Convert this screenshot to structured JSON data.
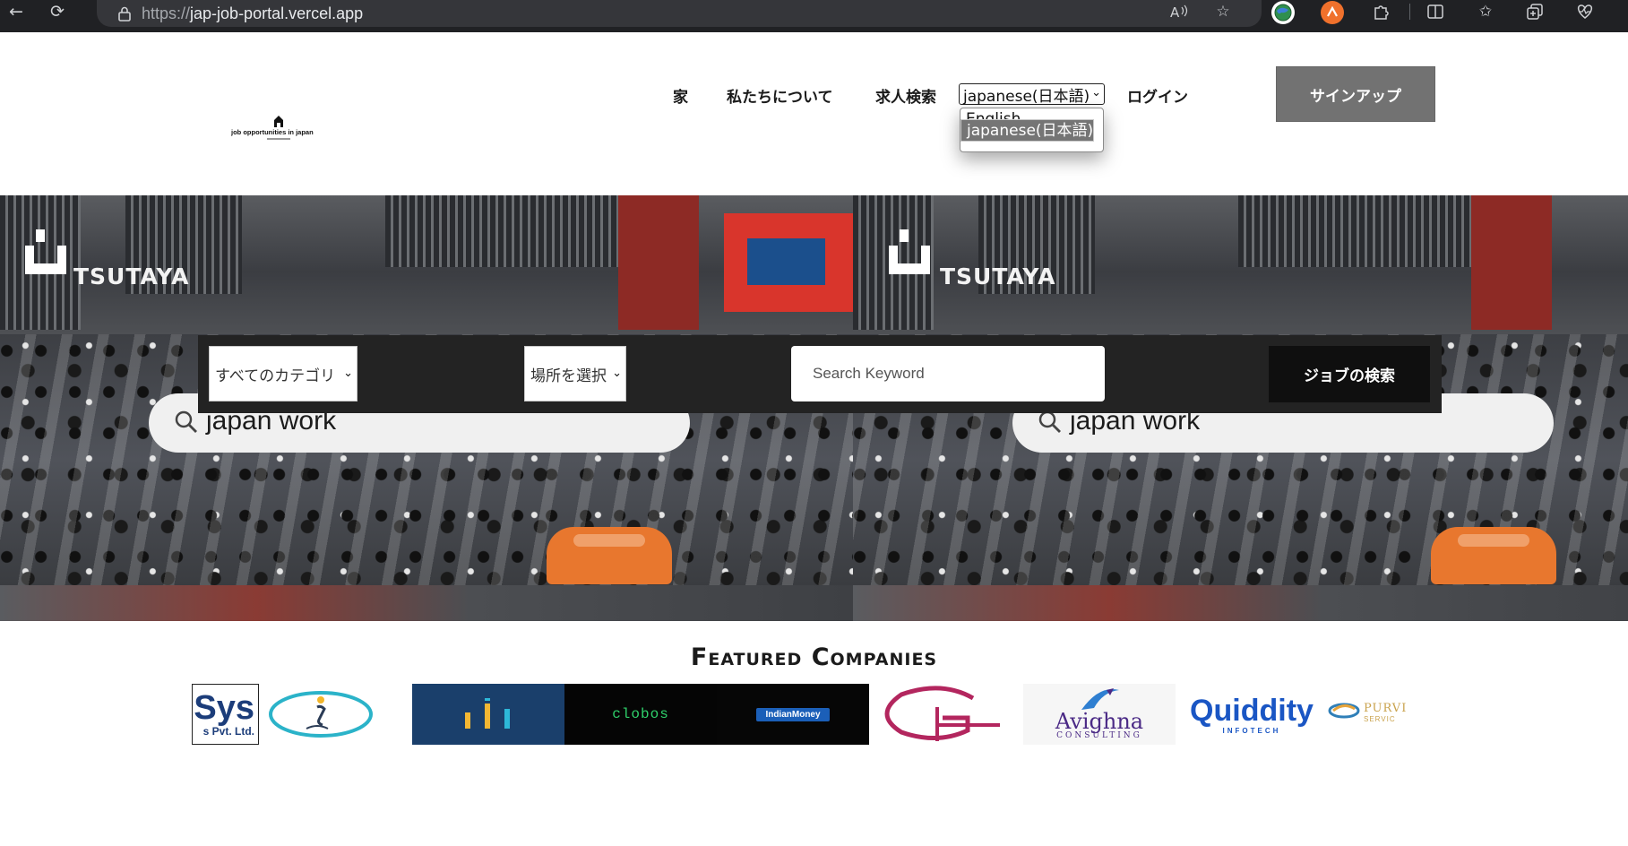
{
  "browser": {
    "url_scheme": "https://",
    "url_host": "jap-job-portal.vercel.app",
    "back_icon": "back-arrow-icon",
    "reload_icon": "reload-icon",
    "toolbar_icons": [
      "read-aloud-icon",
      "favorite-star-icon",
      "extension-globe-icon",
      "extension-orange-icon",
      "extensions-puzzle-icon",
      "split-screen-icon",
      "favorites-icon",
      "collections-icon",
      "browser-health-icon"
    ]
  },
  "brand": {
    "logo_text": "job opportunities in japan"
  },
  "nav": {
    "home": "家",
    "about": "私たちについて",
    "job_search": "求人検索",
    "language_selected": "japanese(日本語)",
    "language_options": [
      "English",
      "japanese(日本語)"
    ],
    "login": "ログイン",
    "signup": "サインアップ"
  },
  "hero": {
    "sign_text": "TSUTAYA",
    "overlay_search_text": "japan work",
    "category_select": "すべてのカテゴリ",
    "location_select": "場所を選択",
    "keyword_placeholder": "Search Keyword",
    "find_jobs_button": "ジョブの検索"
  },
  "featured": {
    "title": "Featured Companies",
    "companies": [
      {
        "name": "Sys",
        "sub": "s Pvt. Ltd."
      },
      {
        "name": "circle-figure-logo"
      },
      {
        "name": "bars-logo"
      },
      {
        "name": "clobos"
      },
      {
        "name": "IndianMoney"
      },
      {
        "name": "G-monogram-logo"
      },
      {
        "name": "Avighna",
        "sub": "CONSULTING"
      },
      {
        "name": "Quiddity",
        "sub": "INFOTECH"
      },
      {
        "name": "PURVI",
        "sub": "SERVIC"
      }
    ]
  },
  "colors": {
    "signup_bg": "#727272",
    "searchbar_bg": "#232323",
    "find_button_bg": "#0f0f0f",
    "quiddity_blue": "#1a56c4",
    "g_logo_magenta": "#b3265e",
    "avighna_purple": "#4b2a86"
  }
}
